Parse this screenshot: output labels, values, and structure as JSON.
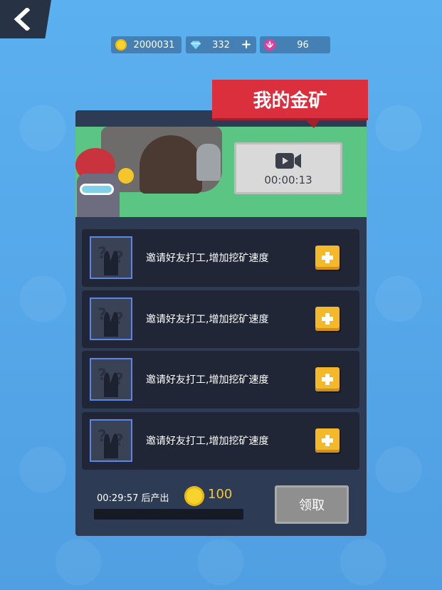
{
  "top_bar": {
    "gold": "2000031",
    "gems": "332",
    "gems_add": "+",
    "tickets": "96"
  },
  "mine": {
    "title": "我的金矿",
    "video_timer": "00:00:13"
  },
  "invite_slots": [
    {
      "text": "邀请好友打工,增加挖矿速度"
    },
    {
      "text": "邀请好友打工,增加挖矿速度"
    },
    {
      "text": "邀请好友打工,增加挖矿速度"
    },
    {
      "text": "邀请好友打工,增加挖矿速度"
    }
  ],
  "production": {
    "timer": "00:29:57 后产出",
    "reward": "100",
    "progress": 0.0,
    "claim_label": "领取"
  },
  "icons": {
    "back": "chevron-left-icon",
    "gold": "coin-icon",
    "gems": "diamond-icon",
    "tickets": "pink-flower-icon",
    "video": "video-camera-icon",
    "add": "plus-icon",
    "avatar": "unknown-friend-icon"
  },
  "colors": {
    "background": "#57a9ea",
    "panel": "#2e3b55",
    "banner": "#db2f3e",
    "accent_gold": "#f7c52e",
    "slot_border": "#5d85e8"
  }
}
